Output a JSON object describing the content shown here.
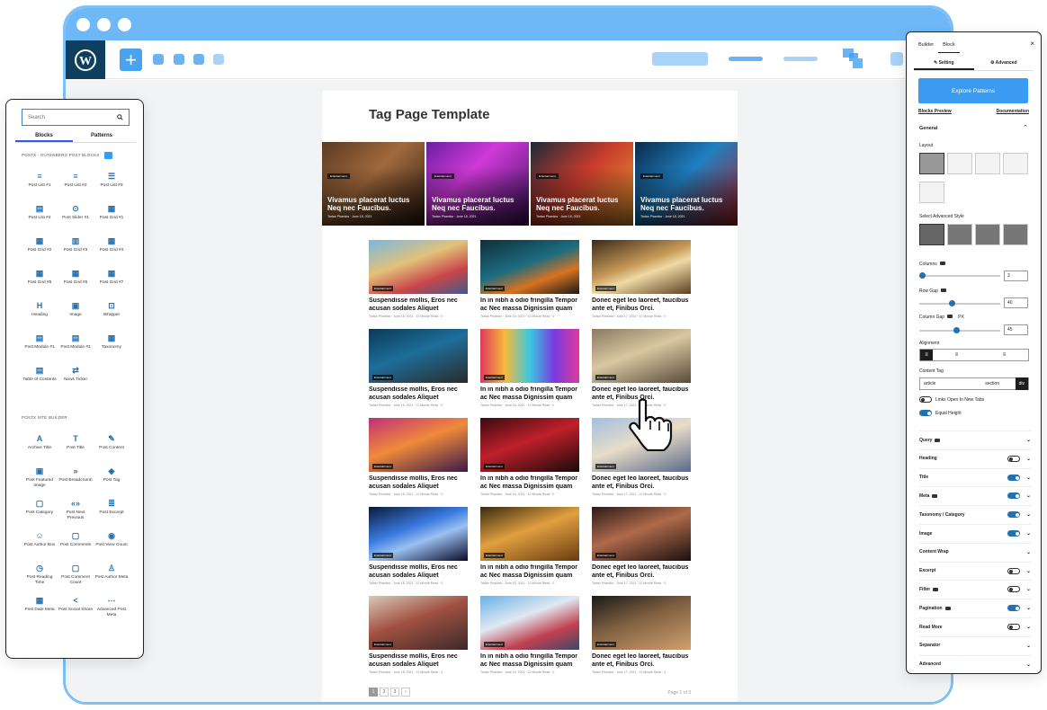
{
  "colors": {
    "accent": "#3b9bf0",
    "browser_frame": "#6fb8f7",
    "wp_dark": "#0e3f5e",
    "toggle_on": "#2271b1"
  },
  "editor": {
    "page_title": "Tag Page Template"
  },
  "hero_cards": [
    {
      "badge": "Entertainment",
      "title": "Vivamus placerat luctus Neq nec Faucibus.",
      "meta": "Tartan Phantics · June 18, 2021"
    },
    {
      "badge": "Entertainment",
      "title": "Vivamus placerat luctus Neq nec Faucibus.",
      "meta": "Tartan Phantics · June 18, 2021"
    },
    {
      "badge": "Entertainment",
      "title": "Vivamus placerat luctus Neq nec Faucibus.",
      "meta": "Tartan Phantics · June 18, 2021"
    },
    {
      "badge": "Entertainment",
      "title": "Vivamus placerat luctus Neq nec Faucibus.",
      "meta": "Tartan Phantics · June 18, 2021"
    }
  ],
  "posts": [
    {
      "badge": "Entertainment",
      "title": "Suspendisse mollis, Eros nec acusan sodales Aliquet",
      "meta": "Tartan Phantics · June 18, 2021 · 12 Minute Read · 0"
    },
    {
      "badge": "Entertainment",
      "title": "In in nibh a odio fringilla Tempor ac Nec massa Dignissim quam",
      "meta": "Tartan Phantics · June 18, 2021 · 12 Minute Read · 0"
    },
    {
      "badge": "Entertainment",
      "title": "Donec eget leo laoreet, faucibus ante et, Finibus Orci.",
      "meta": "Tartan Phantics · June 17, 2021 · 12 Minute Read · 0"
    },
    {
      "badge": "Entertainment",
      "title": "Suspendisse mollis, Eros nec acusan sodales Aliquet",
      "meta": "Tartan Phantics · June 18, 2021 · 12 Minute Read · 0"
    },
    {
      "badge": "Entertainment",
      "title": "In in nibh a odio fringilla Tempor ac Nec massa Dignissim quam",
      "meta": "Tartan Phantics · June 18, 2021 · 12 Minute Read · 0"
    },
    {
      "badge": "Entertainment",
      "title": "Donec eget leo laoreet, faucibus ante et, Finibus Orci.",
      "meta": "Tartan Phantics · June 17, 2021 · 12 Minute Read · 0"
    },
    {
      "badge": "Entertainment",
      "title": "Suspendisse mollis, Eros nec acusan sodales Aliquet",
      "meta": "Tartan Phantics · June 18, 2021 · 12 Minute Read · 0"
    },
    {
      "badge": "Entertainment",
      "title": "In in nibh a odio fringilla Tempor ac Nec massa Dignissim quam",
      "meta": "Tartan Phantics · June 18, 2021 · 12 Minute Read · 0"
    },
    {
      "badge": "Entertainment",
      "title": "Donec eget leo laoreet, faucibus ante et, Finibus Orci.",
      "meta": "Tartan Phantics · June 17, 2021 · 12 Minute Read · 0"
    },
    {
      "badge": "Entertainment",
      "title": "Suspendisse mollis, Eros nec acusan sodales Aliquet",
      "meta": "Tartan Phantics · June 18, 2021 · 12 Minute Read · 0"
    },
    {
      "badge": "Entertainment",
      "title": "In in nibh a odio fringilla Tempor ac Nec massa Dignissim quam",
      "meta": "Tartan Phantics · June 18, 2021 · 12 Minute Read · 0"
    },
    {
      "badge": "Entertainment",
      "title": "Donec eget leo laoreet, faucibus ante et, Finibus Orci.",
      "meta": "Tartan Phantics · June 17, 2021 · 12 Minute Read · 0"
    },
    {
      "badge": "Entertainment",
      "title": "Suspendisse mollis, Eros nec acusan sodales Aliquet",
      "meta": "Tartan Phantics · June 18, 2021 · 12 Minute Read · 0"
    },
    {
      "badge": "Entertainment",
      "title": "In in nibh a odio fringilla Tempor ac Nec massa Dignissim quam",
      "meta": "Tartan Phantics · June 18, 2021 · 12 Minute Read · 0"
    },
    {
      "badge": "Entertainment",
      "title": "Donec eget leo laoreet, faucibus ante et, Finibus Orci.",
      "meta": "Tartan Phantics · June 17, 2021 · 12 Minute Read · 0"
    }
  ],
  "pagination": {
    "pages": [
      "1",
      "2",
      "3",
      "›"
    ],
    "current": "1",
    "page_of": "Page 1 of 3"
  },
  "left_panel": {
    "search_placeholder": "Search",
    "tabs": [
      "Blocks",
      "Patterns"
    ],
    "section1": "POSTX - GUTENBERG POST BLOCKS",
    "section2": "POSTX SITE BUILDER",
    "blocks1": [
      {
        "label": "Post List #1",
        "icon": "≡"
      },
      {
        "label": "Post List #2",
        "icon": "≡"
      },
      {
        "label": "Post List #3",
        "icon": "☰"
      },
      {
        "label": "Post List #4",
        "icon": "▤"
      },
      {
        "label": "Post Slider #1",
        "icon": "⊙"
      },
      {
        "label": "Post Grid #1",
        "icon": "▦"
      },
      {
        "label": "Post Grid #2",
        "icon": "▦"
      },
      {
        "label": "Post Grid #3",
        "icon": "▥"
      },
      {
        "label": "Post Grid #4",
        "icon": "▦"
      },
      {
        "label": "Post Grid #5",
        "icon": "▦"
      },
      {
        "label": "Post Grid #6",
        "icon": "▦"
      },
      {
        "label": "Post Grid #7",
        "icon": "▦"
      },
      {
        "label": "Heading",
        "icon": "H"
      },
      {
        "label": "Image",
        "icon": "▣"
      },
      {
        "label": "Wrapper",
        "icon": "⊡"
      },
      {
        "label": "Post Module #1",
        "icon": "▤"
      },
      {
        "label": "Post Module #2",
        "icon": "▤"
      },
      {
        "label": "Taxonomy",
        "icon": "▦"
      },
      {
        "label": "Table of Contents",
        "icon": "▤"
      },
      {
        "label": "News Ticker",
        "icon": "⇄"
      }
    ],
    "blocks2": [
      {
        "label": "Archive Title",
        "icon": "A"
      },
      {
        "label": "Post Title",
        "icon": "T"
      },
      {
        "label": "Post Content",
        "icon": "✎"
      },
      {
        "label": "Post Featured Image",
        "icon": "▣"
      },
      {
        "label": "Post Breadcrumb",
        "icon": "»"
      },
      {
        "label": "Post Tag",
        "icon": "◆"
      },
      {
        "label": "Post Category",
        "icon": "▢"
      },
      {
        "label": "Post Next Previous",
        "icon": "«»"
      },
      {
        "label": "Post Excerpt",
        "icon": "≣"
      },
      {
        "label": "Post Author Box",
        "icon": "☺"
      },
      {
        "label": "Post Comments",
        "icon": "▢"
      },
      {
        "label": "Post View Count",
        "icon": "◉"
      },
      {
        "label": "Post Reading Time",
        "icon": "◷"
      },
      {
        "label": "Post Comment Count",
        "icon": "▢"
      },
      {
        "label": "Post Author Meta",
        "icon": "♙"
      },
      {
        "label": "Post Date Meta",
        "icon": "▦"
      },
      {
        "label": "Post Social Share",
        "icon": "<"
      },
      {
        "label": "Advanced Post Meta",
        "icon": "⋯"
      }
    ]
  },
  "right_panel": {
    "tabs": [
      "Builder",
      "Block"
    ],
    "close": "×",
    "subtabs": [
      "Setting",
      "Advanced"
    ],
    "explore": "Explore Patterns",
    "link_preview": "Blocks Preview",
    "link_docs": "Documentation",
    "general": "General",
    "layout": "Layout",
    "adv_style": "Select Advanced Style",
    "columns": "Columns",
    "columns_val": "3",
    "columns_level": 0.03,
    "row_gap": "Row Gap",
    "row_gap_val": "40",
    "row_gap_level": 0.4,
    "col_gap": "Column Gap",
    "col_gap_unit": "PX",
    "col_gap_val": "45",
    "col_gap_level": 0.45,
    "alignment": "Alignment",
    "content_tag": "Content Tag",
    "tags": [
      "article",
      "section",
      "div"
    ],
    "links_new_tab": "Links Open In New Tabs",
    "equal_height": "Equal Height",
    "sections": [
      {
        "label": "Query",
        "toggle": null,
        "badge": true
      },
      {
        "label": "Heading",
        "toggle": false,
        "badge": false
      },
      {
        "label": "Title",
        "toggle": true,
        "badge": false
      },
      {
        "label": "Meta",
        "toggle": true,
        "badge": true
      },
      {
        "label": "Taxonomy / Category",
        "toggle": true,
        "badge": false
      },
      {
        "label": "Image",
        "toggle": true,
        "badge": false
      },
      {
        "label": "Content Wrap",
        "toggle": null,
        "badge": false
      },
      {
        "label": "Excerpt",
        "toggle": false,
        "badge": false
      },
      {
        "label": "Filter",
        "toggle": false,
        "badge": true
      },
      {
        "label": "Pagination",
        "toggle": true,
        "badge": true
      },
      {
        "label": "Read More",
        "toggle": false,
        "badge": false
      },
      {
        "label": "Separator",
        "toggle": null,
        "badge": false
      },
      {
        "label": "Advanced",
        "toggle": null,
        "badge": false
      }
    ]
  }
}
